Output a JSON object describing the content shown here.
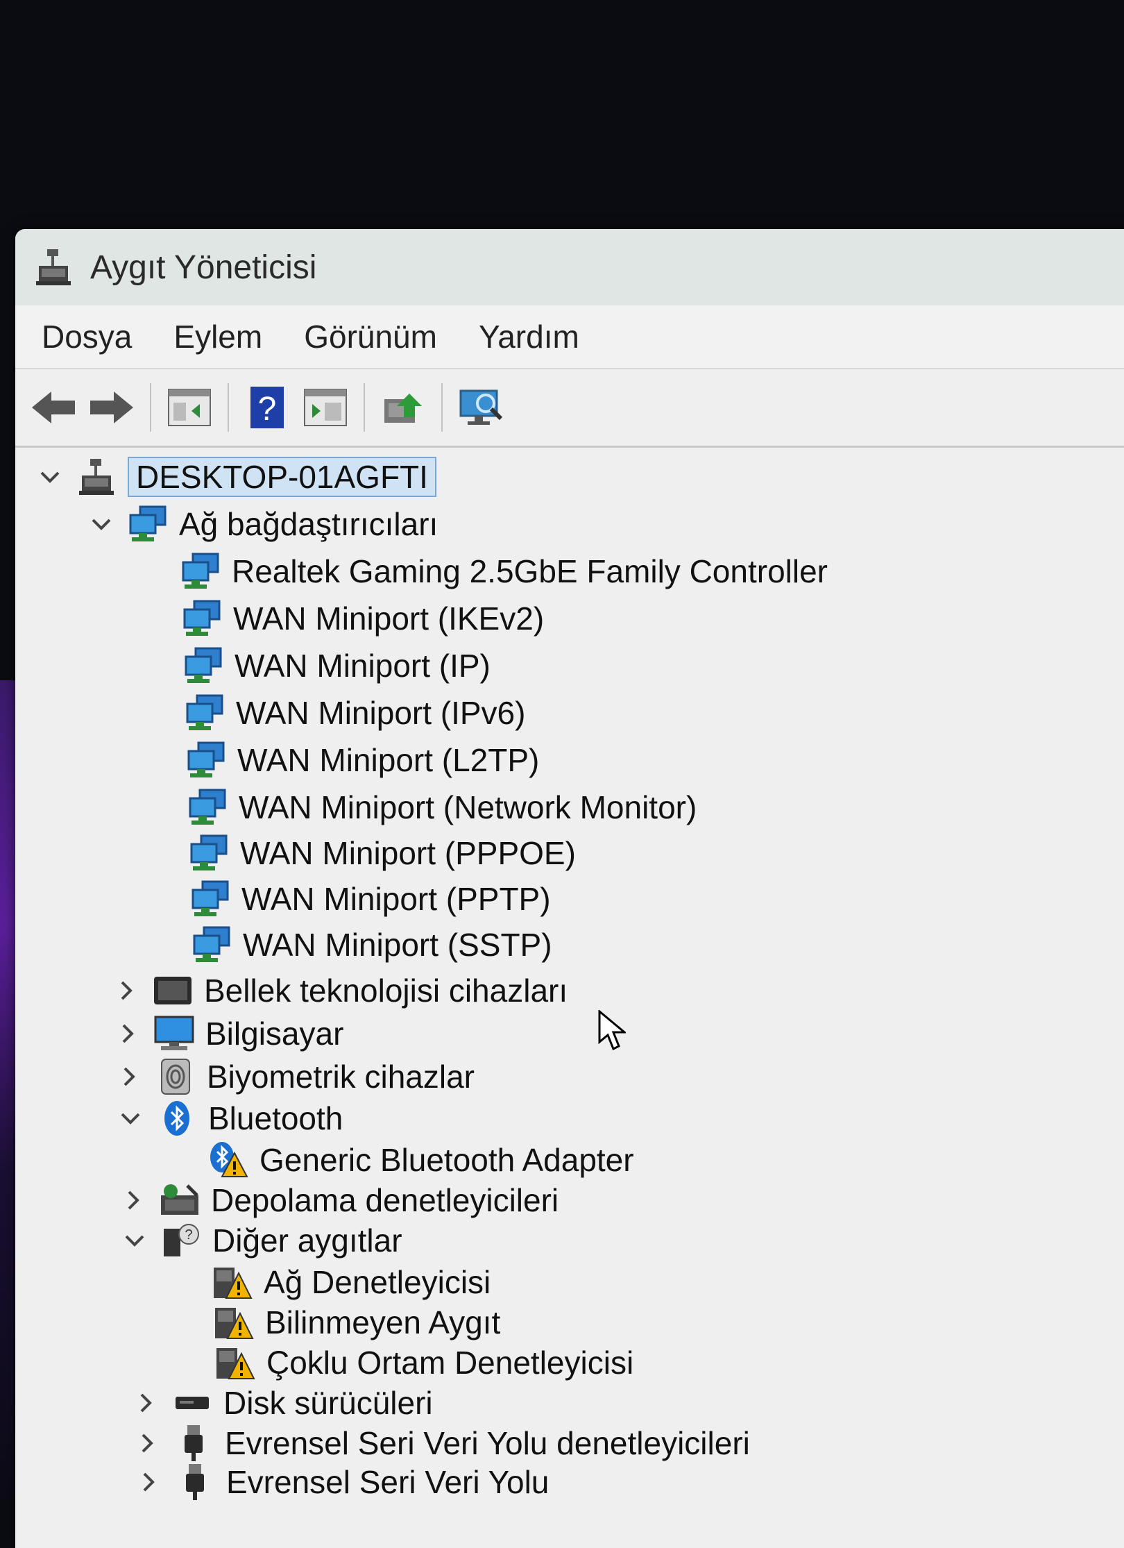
{
  "window": {
    "title": "Aygıt Yöneticisi"
  },
  "menu": [
    "Dosya",
    "Eylem",
    "Görünüm",
    "Yardım"
  ],
  "toolbar": {
    "buttons": [
      "back-arrow-icon",
      "forward-arrow-icon",
      "console-tree-icon",
      "help-icon",
      "properties-icon",
      "update-driver-icon",
      "scan-hardware-icon"
    ]
  },
  "tree": {
    "root": "DESKTOP-01AGFTI",
    "network_adapters": {
      "label": "Ağ bağdaştırıcıları",
      "items": [
        "Realtek Gaming 2.5GbE Family Controller",
        "WAN Miniport (IKEv2)",
        "WAN Miniport (IP)",
        "WAN Miniport (IPv6)",
        "WAN Miniport (L2TP)",
        "WAN Miniport (Network Monitor)",
        "WAN Miniport (PPPOE)",
        "WAN Miniport (PPTP)",
        "WAN Miniport (SSTP)"
      ]
    },
    "memory_tech": "Bellek teknolojisi cihazları",
    "computer": "Bilgisayar",
    "biometric": "Biyometrik cihazlar",
    "bluetooth": {
      "label": "Bluetooth",
      "items": [
        "Generic Bluetooth Adapter"
      ]
    },
    "storage": "Depolama denetleyicileri",
    "other": {
      "label": "Diğer aygıtlar",
      "items": [
        "Ağ Denetleyicisi",
        "Bilinmeyen Aygıt",
        "Çoklu Ortam Denetleyicisi"
      ]
    },
    "disk": "Disk sürücüleri",
    "usb": "Evrensel Seri Veri Yolu denetleyicileri",
    "usb2": "Evrensel Seri Veri Yolu"
  },
  "colors": {
    "accent": "#1a73c8",
    "selection": "#cfe3f5",
    "warning": "#f0b400"
  }
}
